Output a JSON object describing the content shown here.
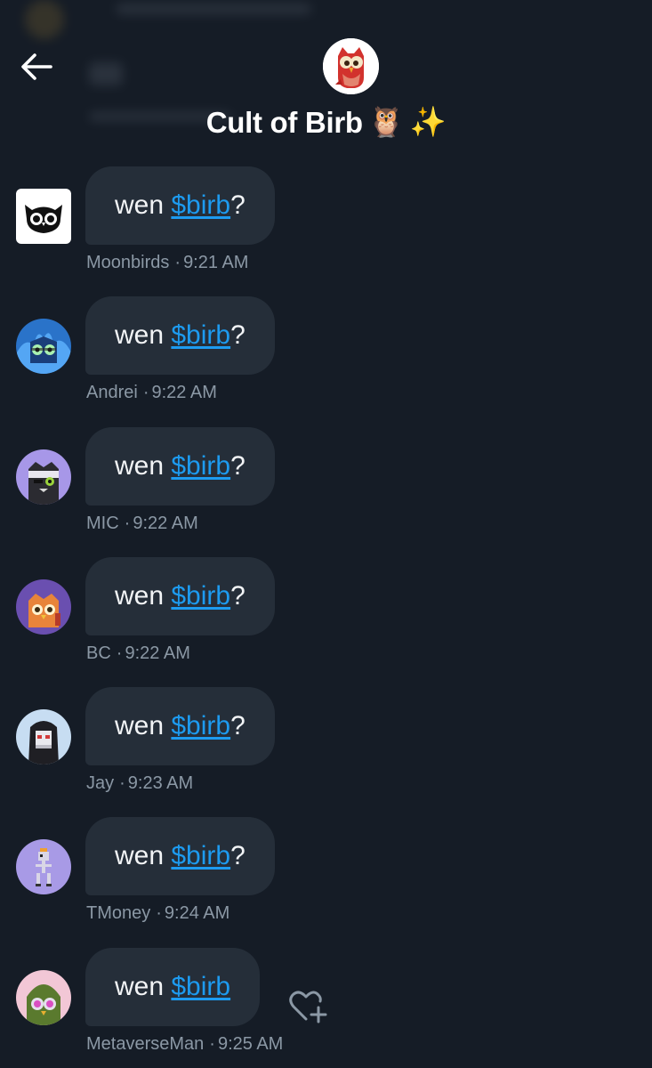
{
  "header": {
    "title": "Cult of Birb",
    "title_emoji_1": "🦉",
    "title_emoji_2": "✨"
  },
  "messages": [
    {
      "prefix": "wen ",
      "cashtag": "$birb",
      "suffix": "?",
      "sender": "Moonbirds",
      "time": "9:21 AM",
      "avatar": "owl-logo-avatar"
    },
    {
      "prefix": "wen ",
      "cashtag": "$birb",
      "suffix": "?",
      "sender": "Andrei",
      "time": "9:22 AM",
      "avatar": "blue-flame-owl-avatar"
    },
    {
      "prefix": "wen ",
      "cashtag": "$birb",
      "suffix": "?",
      "sender": "MIC",
      "time": "9:22 AM",
      "avatar": "bandana-owl-avatar"
    },
    {
      "prefix": "wen ",
      "cashtag": "$birb",
      "suffix": "?",
      "sender": "BC",
      "time": "9:22 AM",
      "avatar": "orange-owl-avatar"
    },
    {
      "prefix": "wen ",
      "cashtag": "$birb",
      "suffix": "?",
      "sender": "Jay",
      "time": "9:23 AM",
      "avatar": "hooded-skull-avatar"
    },
    {
      "prefix": "wen ",
      "cashtag": "$birb",
      "suffix": "?",
      "sender": "TMoney",
      "time": "9:24 AM",
      "avatar": "skeleton-avatar"
    },
    {
      "prefix": "wen ",
      "cashtag": "$birb",
      "suffix": "",
      "sender": "MetaverseMan",
      "time": "9:25 AM",
      "avatar": "green-hood-owl-avatar"
    }
  ],
  "meta_separator": "·",
  "colors": {
    "background": "#151c26",
    "bubble": "#252e39",
    "link": "#1d9bf0",
    "meta_text": "#8b98a5"
  }
}
